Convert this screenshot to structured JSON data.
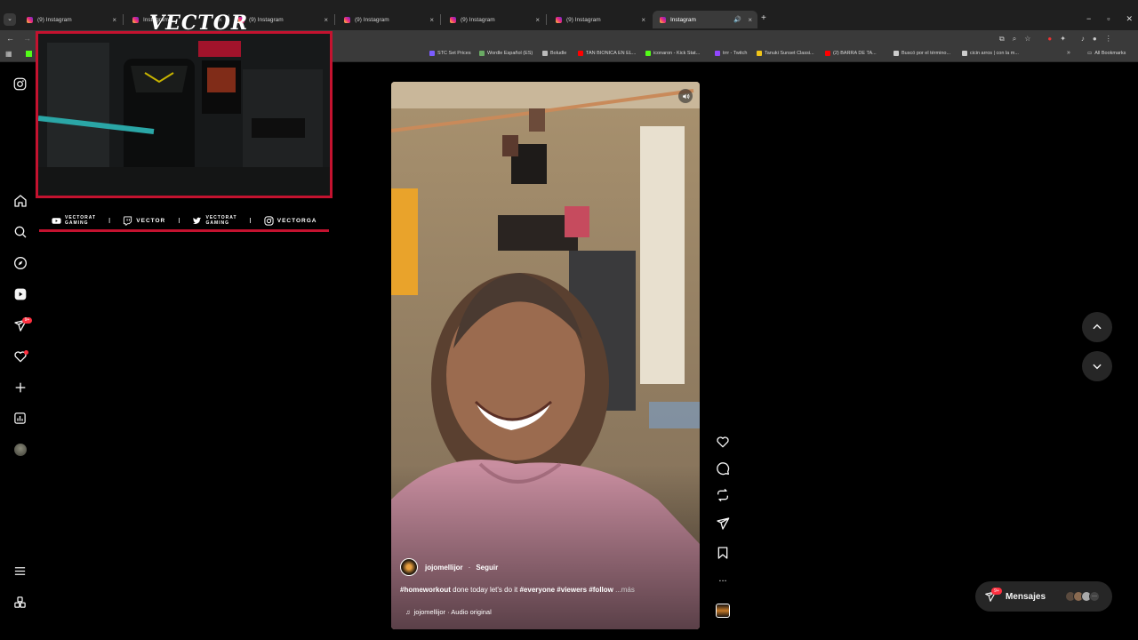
{
  "browser": {
    "tabs": [
      {
        "title": "(9) Instagram"
      },
      {
        "title": "Instagram"
      },
      {
        "title": "(9) Instagram"
      },
      {
        "title": "(9) Instagram"
      },
      {
        "title": "(9) Instagram"
      },
      {
        "title": "(9) Instagram"
      },
      {
        "title": "Instagram"
      }
    ],
    "new_tab": "+",
    "bookmarks": [
      {
        "label": "STC Set Prices",
        "color": "#7b5cff"
      },
      {
        "label": "Wordle Español (ES)",
        "color": "#6aaa64"
      },
      {
        "label": "Boludle",
        "color": "#bbbbbb"
      },
      {
        "label": "TAN BIONICA EN EL...",
        "color": "#ff0000"
      },
      {
        "label": "iconaron - Kick Stat...",
        "color": "#53fc18"
      },
      {
        "label": "trrr - Twitch",
        "color": "#9146ff"
      },
      {
        "label": "Tanuki Sunset Classi...",
        "color": "#f0c419"
      },
      {
        "label": "(2) BARRA DE TA...",
        "color": "#ff0000"
      },
      {
        "label": "Buscó por el término...",
        "color": "#cccccc"
      },
      {
        "label": "cicin arros | con la m...",
        "color": "#cccccc"
      }
    ],
    "all_bookmarks": "All Bookmarks"
  },
  "overlay": {
    "logo": "VECTOR",
    "socials": [
      {
        "icon": "youtube-icon",
        "line1": "VECTORAT",
        "line2": "GAMING"
      },
      {
        "icon": "twitch-icon",
        "line1": "VECTOR",
        "line2": ""
      },
      {
        "icon": "twitter-icon",
        "line1": "VECTORAT",
        "line2": "GAMING"
      },
      {
        "icon": "instagram-icon",
        "line1": "VECTORGA",
        "line2": ""
      }
    ],
    "separator": "I"
  },
  "sidebar": {
    "notifications_badge": "9+"
  },
  "reel": {
    "username": "jojomellijor",
    "follow": "Seguir",
    "caption_tags1": "#homeworkout",
    "caption_text": " done today let's do it ",
    "caption_tags2": "#everyone #viewers #follow",
    "caption_more": " ...más",
    "audio": "jojomellijor · Audio original",
    "more": "..."
  },
  "messages": {
    "label": "Mensajes",
    "badge": "9+"
  },
  "colors": {
    "accent_red": "#c4122f",
    "badge_red": "#ff3040",
    "bg": "#000000"
  }
}
